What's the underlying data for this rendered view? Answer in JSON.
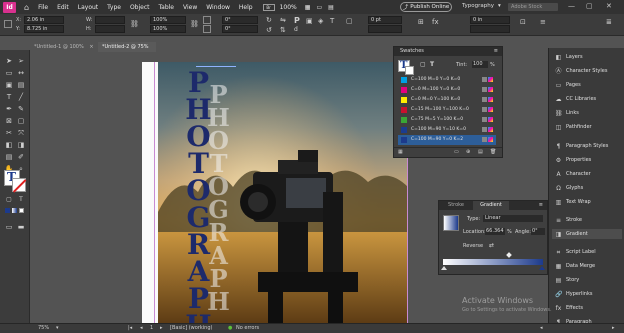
{
  "menubar": {
    "logo": "Id",
    "items": [
      "File",
      "Edit",
      "Layout",
      "Type",
      "Object",
      "Table",
      "View",
      "Window",
      "Help"
    ],
    "publish_label": "Publish Online",
    "workspace": "Typography",
    "stock_placeholder": "Adobe Stock"
  },
  "control": {
    "x_label": "X:",
    "x_value": "2.06 in",
    "y_label": "Y:",
    "y_value": "8.725 in",
    "w_label": "W:",
    "h_label": "H:",
    "scale_x": "100%",
    "scale_y": "100%",
    "rotate": "0°",
    "shear": "0°",
    "stroke": "0 pt",
    "fit_value": "0 in",
    "zoom_percent": "100%"
  },
  "tabs": [
    {
      "label": "*Untitled-1 @ 100%"
    },
    {
      "label": "*Untitled-2 @ 75%"
    }
  ],
  "page_text": {
    "vertical_word_1": "PHOTOGRAPH",
    "vertical_word_2": "PHOTOGRAPH"
  },
  "swatches": {
    "title": "Swatches",
    "tint_label": "Tint:",
    "tint_value": "100",
    "tint_unit": "%",
    "rows": [
      {
        "name": "C=100 M=0 Y=0 K=0",
        "color": "#00a0e3"
      },
      {
        "name": "C=0 M=100 Y=0 K=0",
        "color": "#e4007f"
      },
      {
        "name": "C=0 M=0 Y=100 K=0",
        "color": "#ffed00"
      },
      {
        "name": "C=15 M=100 Y=100 K=0",
        "color": "#c8102e"
      },
      {
        "name": "C=75 M=5 Y=100 K=0",
        "color": "#3aa635"
      },
      {
        "name": "C=100 M=90 Y=10 K=0",
        "color": "#1b3c8f"
      },
      {
        "name": "C=100 M=90 Y=0 K=2",
        "color": "#1c3a8c",
        "selected": true
      }
    ]
  },
  "gradient": {
    "tab_stroke": "Stroke",
    "tab_gradient": "Gradient",
    "type_label": "Type:",
    "type_value": "Linear",
    "location_label": "Location:",
    "location_value": "66.364",
    "location_unit": "%",
    "angle_label": "Angle:",
    "angle_value": "0°",
    "reverse_label": "Reverse"
  },
  "dock": {
    "items": [
      {
        "label": "Layers",
        "icon": "layers-icon"
      },
      {
        "label": "Character Styles",
        "icon": "character-styles-icon"
      },
      {
        "label": "Pages",
        "icon": "pages-icon"
      },
      {
        "label": "CC Libraries",
        "icon": "cc-libraries-icon"
      },
      {
        "label": "Links",
        "icon": "links-icon"
      },
      {
        "label": "Pathfinder",
        "icon": "pathfinder-icon"
      },
      {
        "label": "Paragraph Styles",
        "icon": "paragraph-styles-icon"
      },
      {
        "label": "Properties",
        "icon": "properties-icon"
      },
      {
        "label": "Character",
        "icon": "character-icon"
      },
      {
        "label": "Glyphs",
        "icon": "glyphs-icon"
      },
      {
        "label": "Text Wrap",
        "icon": "text-wrap-icon"
      },
      {
        "label": "Stroke",
        "icon": "stroke-icon"
      },
      {
        "label": "Gradient",
        "icon": "gradient-icon",
        "active": true
      },
      {
        "label": "Script Label",
        "icon": "script-label-icon"
      },
      {
        "label": "Data Merge",
        "icon": "data-merge-icon"
      },
      {
        "label": "Story",
        "icon": "story-icon"
      },
      {
        "label": "Hyperlinks",
        "icon": "hyperlinks-icon"
      },
      {
        "label": "Effects",
        "icon": "effects-icon"
      },
      {
        "label": "Paragraph",
        "icon": "paragraph-icon"
      }
    ]
  },
  "status": {
    "zoom": "75%",
    "page": "1",
    "style": "[Basic] (working)",
    "errors": "No errors"
  },
  "watermark": {
    "line1": "Activate Windows",
    "line2": "Go to Settings to activate Windows."
  },
  "colors": {
    "accent": "#2d5e99",
    "title_text": "#1d2a6b",
    "pink_logo": "#d9318f"
  }
}
